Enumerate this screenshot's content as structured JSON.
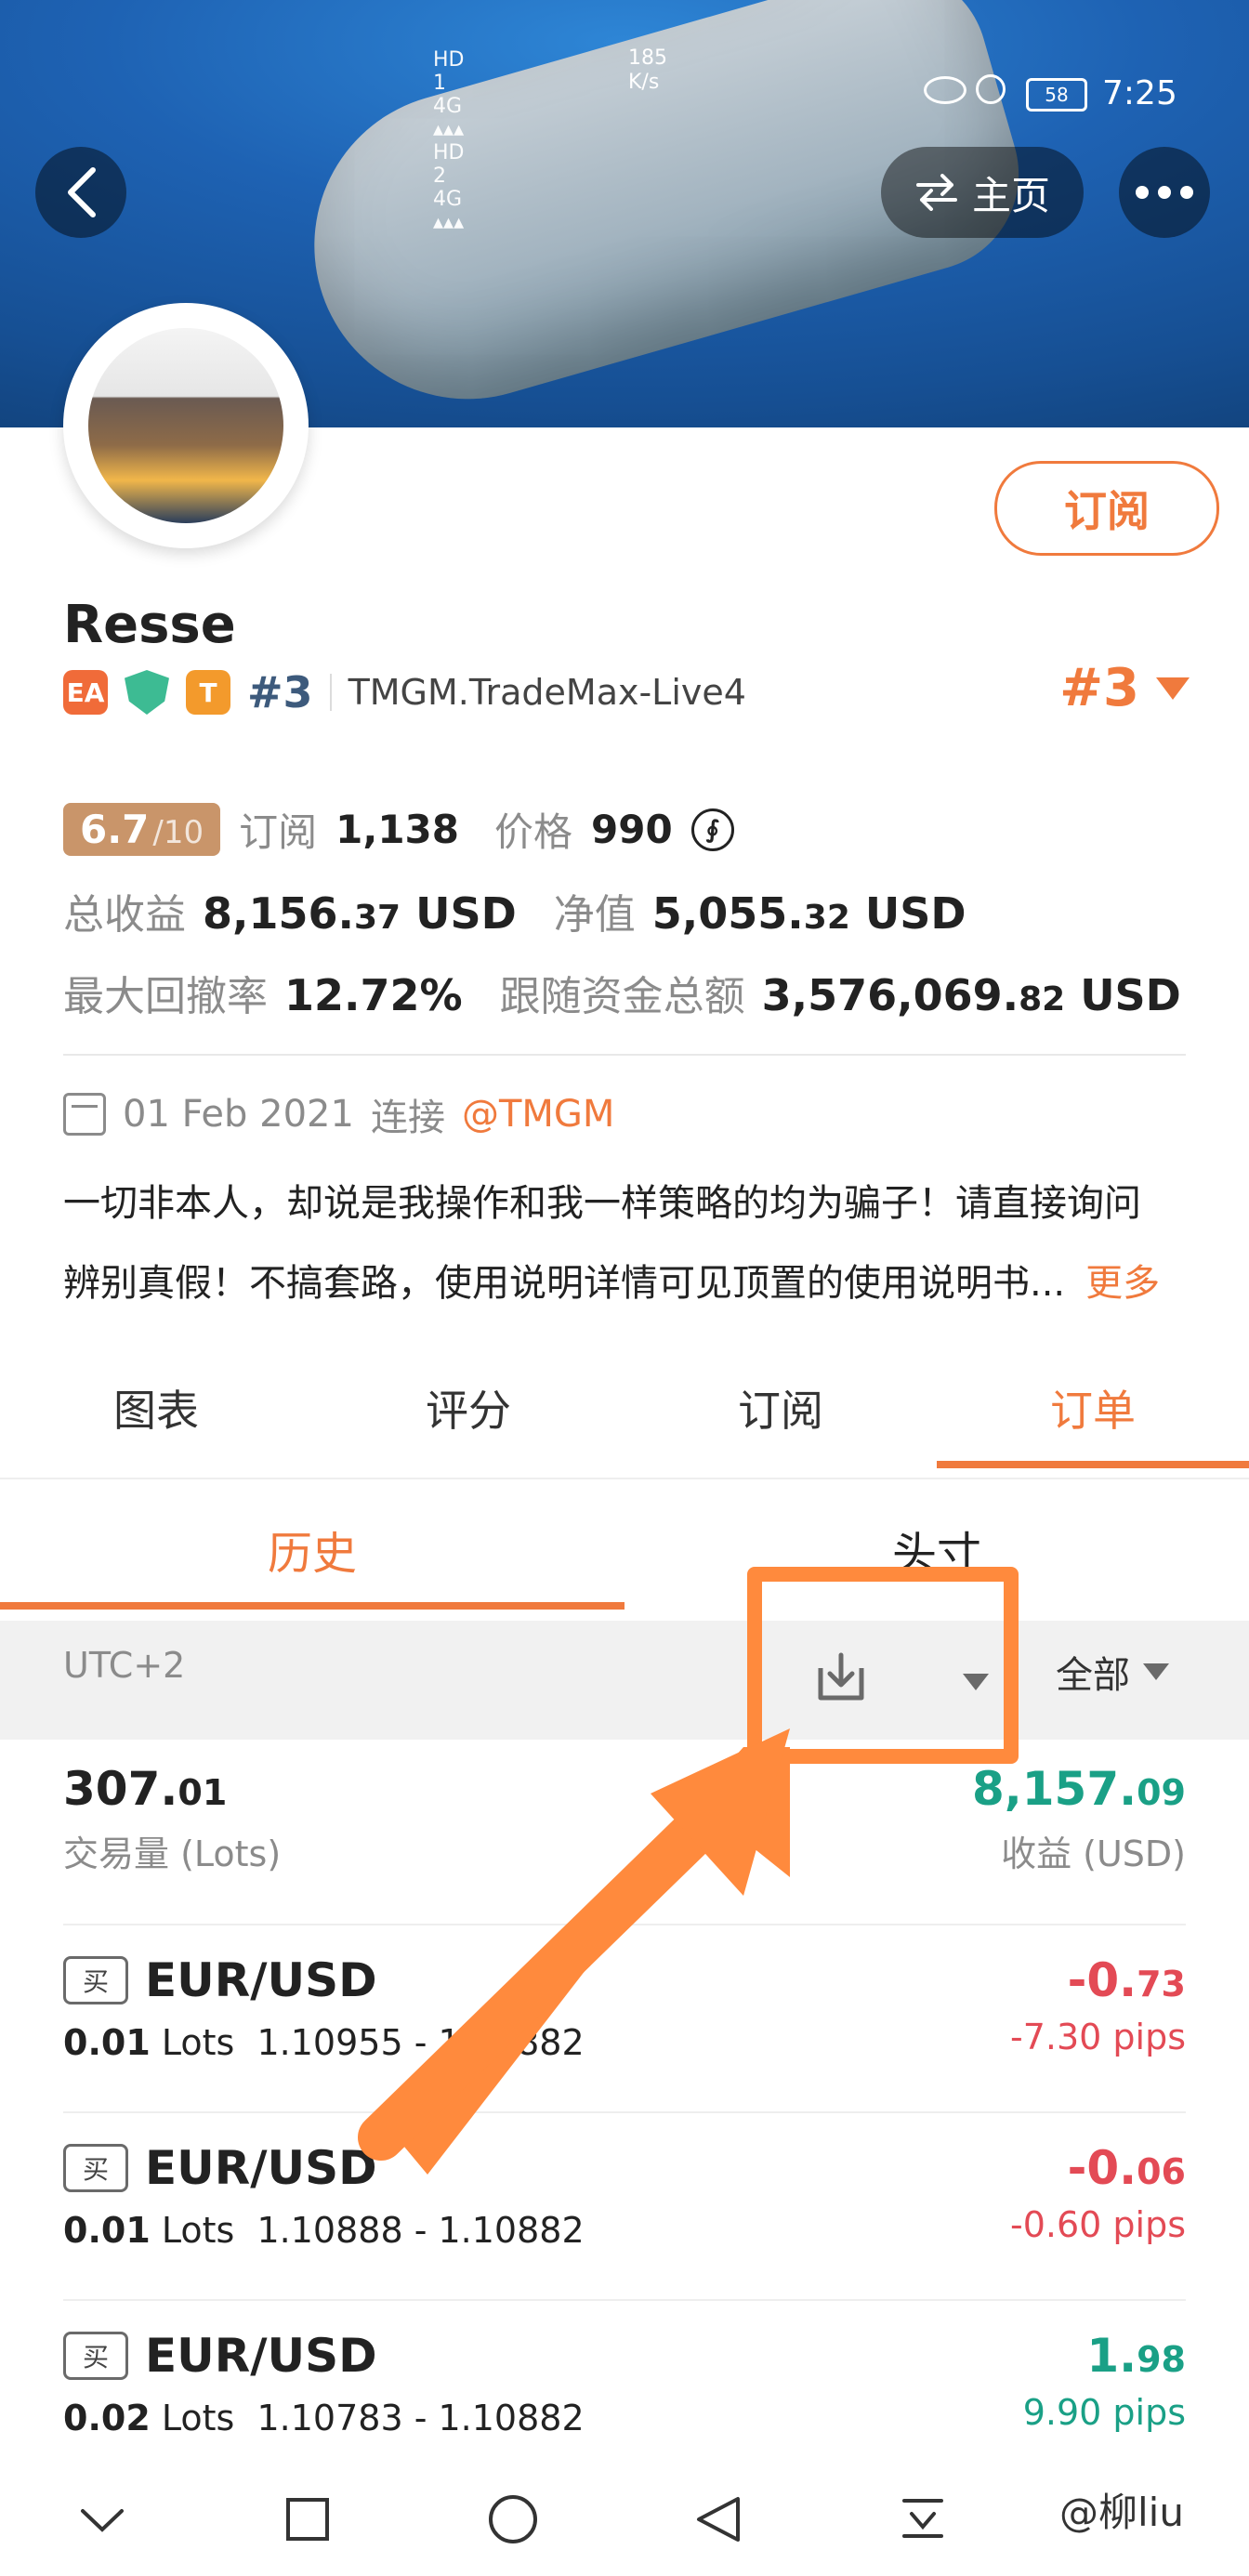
{
  "status_bar": {
    "network": "HD 1 4G ▴▴▴  HD 2 4G ▴▴▴",
    "speed_value": "185",
    "speed_unit": "K/s",
    "battery": "58",
    "time": "7:25"
  },
  "header": {
    "home_label": "主页"
  },
  "profile": {
    "subscribe_label": "订阅",
    "name": "Resse",
    "badges": [
      "EA",
      "T"
    ],
    "rank_small": "#3",
    "server": "TMGM.TradeMax-Live4",
    "rank_big": "#3",
    "score_value": "6.7",
    "score_den": "/10",
    "subscribe_count_label": "订阅",
    "subscribe_count": "1,138",
    "price_label": "价格",
    "price_value": "990",
    "total_profit_label": "总收益",
    "total_profit_main": "8,156.",
    "total_profit_decimal": "37",
    "total_profit_unit": "USD",
    "equity_label": "净值",
    "equity_main": "5,055.",
    "equity_decimal": "32",
    "equity_unit": "USD",
    "max_drawdown_label": "最大回撤率",
    "max_drawdown_value": "12.72%",
    "follow_funds_label": "跟随资金总额",
    "follow_funds_main": "3,576,069.",
    "follow_funds_decimal": "82",
    "follow_funds_unit": "USD",
    "since_date": "01 Feb 2021",
    "connect_label": "连接",
    "broker_link": "@TMGM",
    "desc_line1": "一切非本人，却说是我操作和我一样策略的均为骗子！请直接询问",
    "desc_line2": "辨别真假！不搞套路，使用说明详情可见顶置的使用说明书...",
    "more_label": "更多"
  },
  "tabs": [
    "图表",
    "评分",
    "订阅",
    "订单"
  ],
  "subtabs": [
    "历史",
    "头寸"
  ],
  "filters": {
    "timezone": "UTC+2",
    "all_label": "全部"
  },
  "summary": {
    "lots_main": "307.",
    "lots_decimal": "01",
    "lots_label": "交易量 (Lots)",
    "profit_main": "8,157.",
    "profit_decimal": "09",
    "profit_label": "收益 (USD)"
  },
  "orders": [
    {
      "side": "买",
      "pair": "EUR/USD",
      "lots": "0.01",
      "lots_unit": "Lots",
      "prices": "1.10955 - 1.10882",
      "pnl_main": "-0.",
      "pnl_decimal": "73",
      "pips": "-7.30 pips",
      "sign": "neg"
    },
    {
      "side": "买",
      "pair": "EUR/USD",
      "lots": "0.01",
      "lots_unit": "Lots",
      "prices": "1.10888 - 1.10882",
      "pnl_main": "-0.",
      "pnl_decimal": "06",
      "pips": "-0.60 pips",
      "sign": "neg"
    },
    {
      "side": "买",
      "pair": "EUR/USD",
      "lots": "0.02",
      "lots_unit": "Lots",
      "prices": "1.10783 - 1.10882",
      "pnl_main": "1.",
      "pnl_decimal": "98",
      "pips": "9.90 pips",
      "sign": "pos"
    }
  ],
  "watermark": "@柳liu",
  "colors": {
    "accent": "#f07a3d",
    "profit_green": "#1aa086",
    "loss_red": "#e34a55",
    "highlight": "#ff8a3d"
  },
  "icons": [
    "back-icon",
    "swap-icon",
    "more-icon",
    "calendar-icon",
    "download-icon",
    "chevron-down-icon",
    "nav-down-icon",
    "nav-square-icon",
    "nav-circle-icon",
    "nav-back-icon",
    "nav-menu-icon"
  ]
}
